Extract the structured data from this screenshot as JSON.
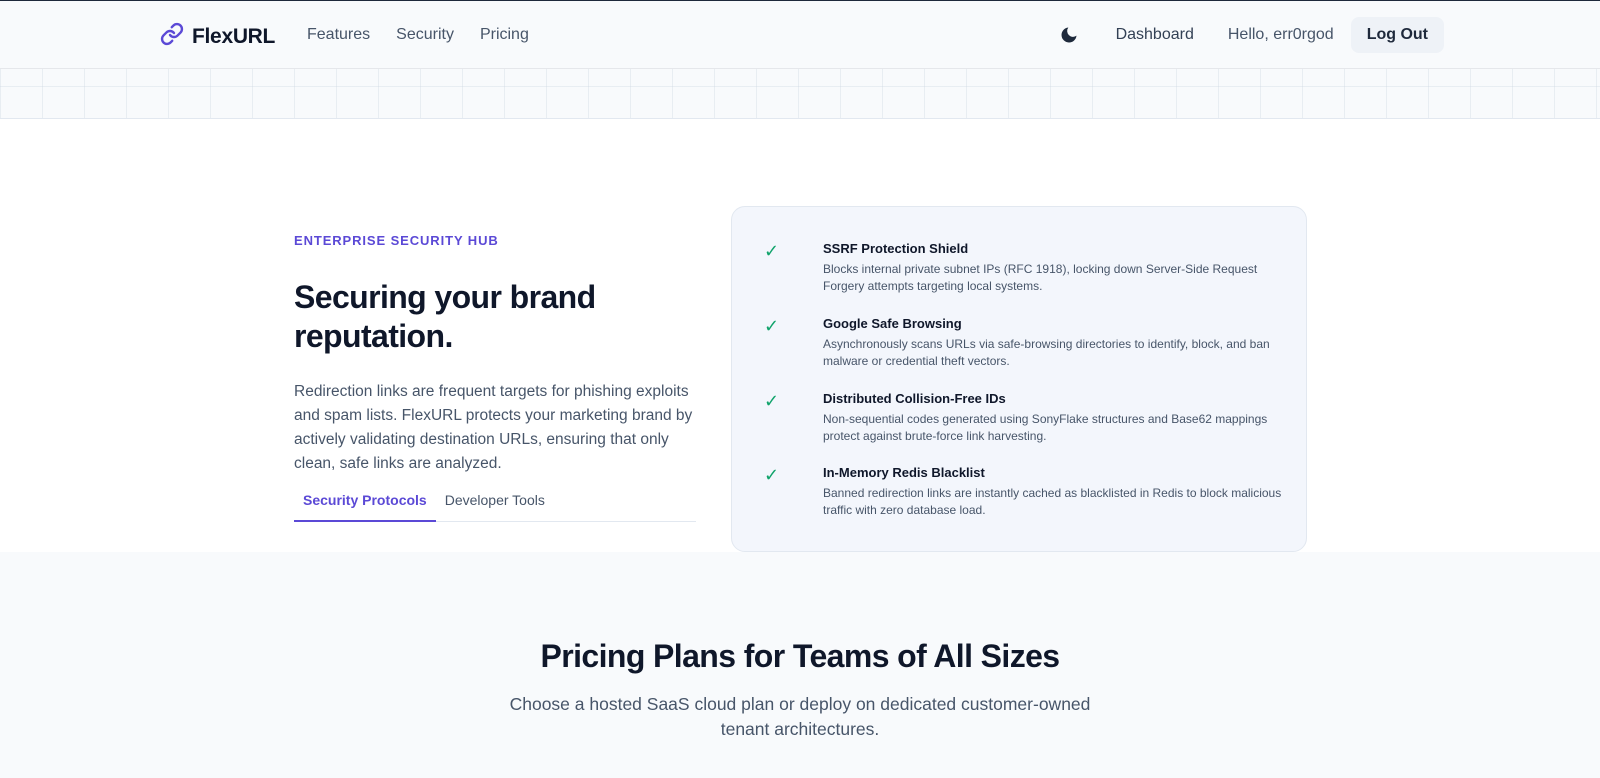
{
  "nav": {
    "brand": "FlexURL",
    "links": [
      "Features",
      "Security",
      "Pricing"
    ],
    "theme_icon": "moon-icon",
    "dashboard": "Dashboard",
    "greeting": "Hello, err0rgod",
    "logout": "Log Out"
  },
  "security": {
    "eyebrow": "ENTERPRISE SECURITY HUB",
    "headline": "Securing your brand reputation.",
    "description": "Redirection links are frequent targets for phishing exploits and spam lists. FlexURL protects your marketing brand by actively validating destination URLs, ensuring that only clean, safe links are analyzed.",
    "tabs": [
      {
        "label": "Security Protocols",
        "active": true
      },
      {
        "label": "Developer Tools",
        "active": false
      }
    ],
    "features": [
      {
        "icon": "check-icon",
        "title": "SSRF Protection Shield",
        "desc": "Blocks internal private subnet IPs (RFC 1918), locking down Server-Side Request Forgery attempts targeting local systems."
      },
      {
        "icon": "check-icon",
        "title": "Google Safe Browsing",
        "desc": "Asynchronously scans URLs via safe-browsing directories to identify, block, and ban malware or credential theft vectors."
      },
      {
        "icon": "check-icon",
        "title": "Distributed Collision-Free IDs",
        "desc": "Non-sequential codes generated using SonyFlake structures and Base62 mappings protect against brute-force link harvesting."
      },
      {
        "icon": "check-icon",
        "title": "In-Memory Redis Blacklist",
        "desc": "Banned redirection links are instantly cached as blacklisted in Redis to block malicious traffic with zero database load."
      }
    ]
  },
  "pricing": {
    "title": "Pricing Plans for Teams of All Sizes",
    "subtitle": "Choose a hosted SaaS cloud plan or deploy on dedicated customer-owned tenant architectures."
  },
  "colors": {
    "accent": "#5b49d6",
    "check": "#10a36b",
    "text": "#0f172a",
    "muted": "#475569"
  }
}
